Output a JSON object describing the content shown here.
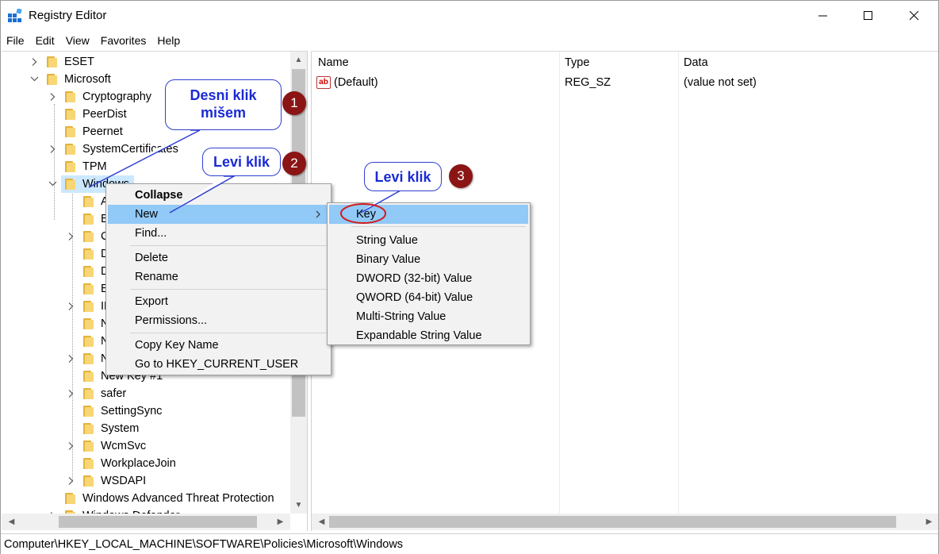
{
  "window": {
    "title": "Registry Editor"
  },
  "menubar": [
    "File",
    "Edit",
    "View",
    "Favorites",
    "Help"
  ],
  "tree": {
    "items": [
      {
        "label": "ESET",
        "depth": 1,
        "expand": "collapsed"
      },
      {
        "label": "Microsoft",
        "depth": 1,
        "expand": "expanded"
      },
      {
        "label": "Cryptography",
        "depth": 2,
        "expand": "collapsed"
      },
      {
        "label": "PeerDist",
        "depth": 2,
        "expand": "none"
      },
      {
        "label": "Peernet",
        "depth": 2,
        "expand": "none"
      },
      {
        "label": "SystemCertificates",
        "depth": 2,
        "expand": "collapsed"
      },
      {
        "label": "TPM",
        "depth": 2,
        "expand": "none"
      },
      {
        "label": "Windows",
        "depth": 2,
        "expand": "expanded",
        "selected": true
      },
      {
        "label": "A",
        "depth": 3,
        "expand": "none"
      },
      {
        "label": "B",
        "depth": 3,
        "expand": "none"
      },
      {
        "label": "C",
        "depth": 3,
        "expand": "collapsed"
      },
      {
        "label": "D",
        "depth": 3,
        "expand": "none"
      },
      {
        "label": "D",
        "depth": 3,
        "expand": "none"
      },
      {
        "label": "E",
        "depth": 3,
        "expand": "none"
      },
      {
        "label": "IP",
        "depth": 3,
        "expand": "collapsed"
      },
      {
        "label": "N",
        "depth": 3,
        "expand": "none"
      },
      {
        "label": "N",
        "depth": 3,
        "expand": "none"
      },
      {
        "label": "N",
        "depth": 3,
        "expand": "collapsed"
      },
      {
        "label": "New Key #1",
        "depth": 3,
        "expand": "none"
      },
      {
        "label": "safer",
        "depth": 3,
        "expand": "collapsed"
      },
      {
        "label": "SettingSync",
        "depth": 3,
        "expand": "none"
      },
      {
        "label": "System",
        "depth": 3,
        "expand": "none"
      },
      {
        "label": "WcmSvc",
        "depth": 3,
        "expand": "collapsed"
      },
      {
        "label": "WorkplaceJoin",
        "depth": 3,
        "expand": "none"
      },
      {
        "label": "WSDAPI",
        "depth": 3,
        "expand": "collapsed"
      },
      {
        "label": "Windows Advanced Threat Protection",
        "depth": 2,
        "expand": "none"
      },
      {
        "label": "Windows Defender",
        "depth": 2,
        "expand": "collapsed"
      }
    ]
  },
  "list": {
    "columns": [
      "Name",
      "Type",
      "Data"
    ],
    "rows": [
      {
        "name": "(Default)",
        "type": "REG_SZ",
        "data": "(value not set)",
        "icon": "ab-string-icon"
      }
    ]
  },
  "context_menu": {
    "items": [
      {
        "label": "Collapse",
        "bold": true
      },
      {
        "label": "New",
        "submenu": true,
        "highlighted": true
      },
      {
        "label": "Find..."
      },
      {
        "separator": true
      },
      {
        "label": "Delete"
      },
      {
        "label": "Rename"
      },
      {
        "separator": true
      },
      {
        "label": "Export"
      },
      {
        "label": "Permissions..."
      },
      {
        "separator": true
      },
      {
        "label": "Copy Key Name"
      },
      {
        "label": "Go to HKEY_CURRENT_USER"
      }
    ]
  },
  "submenu": {
    "items": [
      {
        "label": "Key",
        "highlighted": true
      },
      {
        "separator": true
      },
      {
        "label": "String Value"
      },
      {
        "label": "Binary Value"
      },
      {
        "label": "DWORD (32-bit) Value"
      },
      {
        "label": "QWORD (64-bit) Value"
      },
      {
        "label": "Multi-String Value"
      },
      {
        "label": "Expandable String Value"
      }
    ]
  },
  "annotations": {
    "callout1": "Desni klik mišem",
    "callout2": "Levi klik",
    "callout3": "Levi klik",
    "badge1": "1",
    "badge2": "2",
    "badge3": "3",
    "accent": "#1b2ad4",
    "badge_color": "#8b1515"
  },
  "statusbar": {
    "path": "Computer\\HKEY_LOCAL_MACHINE\\SOFTWARE\\Policies\\Microsoft\\Windows"
  }
}
